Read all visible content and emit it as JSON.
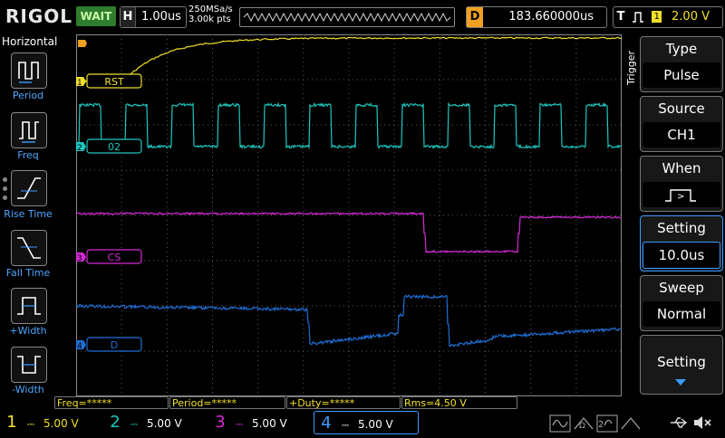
{
  "header": {
    "brand": "RIGOL",
    "run_status": "WAIT",
    "horizontal": {
      "key": "H",
      "timebase": "1.00us"
    },
    "sample_rate": "250MSa/s",
    "mem_depth": "3.00k pts",
    "delay": {
      "key": "D",
      "value": "183.660000us"
    },
    "trigger": {
      "key": "T",
      "channel": "1",
      "level": "2.00 V"
    }
  },
  "left_menu": {
    "title": "Horizontal",
    "items": [
      {
        "label": "Period",
        "icon": "period-icon"
      },
      {
        "label": "Freq",
        "icon": "freq-icon"
      },
      {
        "label": "Rise Time",
        "icon": "rise-time-icon"
      },
      {
        "label": "Fall Time",
        "icon": "fall-time-icon"
      },
      {
        "label": "+Width",
        "icon": "positive-width-icon"
      },
      {
        "label": "-Width",
        "icon": "negative-width-icon"
      }
    ]
  },
  "channels": [
    {
      "num": "1",
      "label": "RST",
      "color": "#f0e02a",
      "scale": "5.00 V"
    },
    {
      "num": "2",
      "label": "02",
      "color": "#1cc7c0",
      "scale": "5.00 V"
    },
    {
      "num": "3",
      "label": "CS",
      "color": "#d42ad4",
      "scale": "5.00 V"
    },
    {
      "num": "4",
      "label": "D",
      "color": "#1f6fd6",
      "scale": "5.00 V"
    }
  ],
  "trigger_menu": {
    "side_label": "Trigger",
    "type": {
      "title": "Type",
      "value": "Pulse"
    },
    "source": {
      "title": "Source",
      "value": "CH1"
    },
    "when": {
      "title": "When",
      "value": "pulse-positive-greater-icon"
    },
    "setting": {
      "title": "Setting",
      "value": "10.0us"
    },
    "sweep": {
      "title": "Sweep",
      "value": "Normal"
    },
    "more": {
      "title": "Setting"
    }
  },
  "measurements": {
    "freq": "Freq=*****",
    "period": "Period=*****",
    "duty": "+Duty=*****",
    "rms": "Rms=4.50 V"
  },
  "colors": {
    "ch1": "#f0e02a",
    "ch2": "#1cc7c0",
    "ch3": "#d42ad4",
    "ch4": "#1f6fd6",
    "accent": "#3a9cff",
    "status": "#2e7d2e"
  }
}
